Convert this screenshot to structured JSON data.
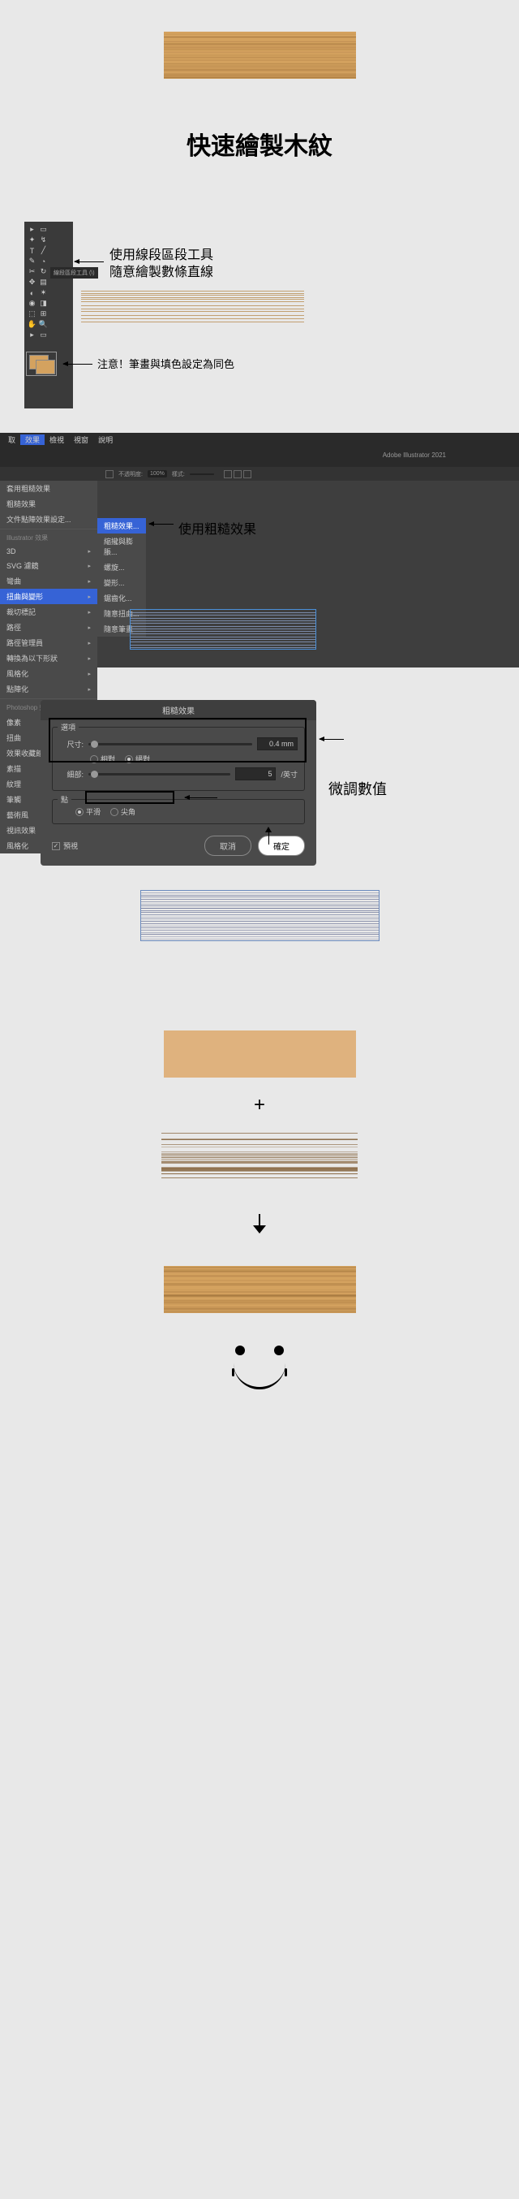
{
  "title": "快速繪製木紋",
  "annotations": {
    "lineTool": "使用線段區段工具\n隨意繪製數條直線",
    "strokeFill": "注意！筆畫與填色設定為同色",
    "roughen": "使用粗糙效果",
    "adjust": "微調數值",
    "toolTooltip": "線段區段工具 (\\)"
  },
  "menubar": [
    "取",
    "效果",
    "檢視",
    "視窗",
    "說明"
  ],
  "appbar": {
    "appName": "Adobe Illustrator 2021"
  },
  "toolbar": {
    "opacity_label": "不透明度:",
    "opacity_val": "100%",
    "style_label": "樣式:"
  },
  "dropdown": {
    "topItems": [
      "套用粗糙效果",
      "粗糙效果",
      "文件點陣效果設定..."
    ],
    "header1": "Illustrator 效果",
    "items1": [
      "3D",
      "SVG 濾鏡",
      "彎曲",
      "扭曲與變形",
      "裁切標記",
      "路徑",
      "路徑管理員",
      "轉換為以下形狀",
      "風格化",
      "點陣化"
    ],
    "header2": "Photoshop 效果",
    "items2": [
      "像素",
      "扭曲",
      "效果收藏館",
      "素描",
      "紋理",
      "筆觸",
      "藝術風",
      "視訊效果",
      "風格化"
    ],
    "submenu": [
      "粗糙效果...",
      "縮攏與膨脹...",
      "螺旋...",
      "變形...",
      "鋸齒化...",
      "隨意扭曲...",
      "隨意筆畫..."
    ]
  },
  "dialog": {
    "title": "粗糙效果",
    "optionsLabel": "選項",
    "sizeLabel": "尺寸:",
    "sizeValue": "0.4 mm",
    "radio1a": "相對",
    "radio1b": "絕對",
    "detailLabel": "細部:",
    "detailValue": "5",
    "detailUnit": "/英寸",
    "pointsLabel": "點",
    "radio2a": "平滑",
    "radio2b": "尖角",
    "preview": "預視",
    "cancel": "取消",
    "ok": "確定"
  }
}
